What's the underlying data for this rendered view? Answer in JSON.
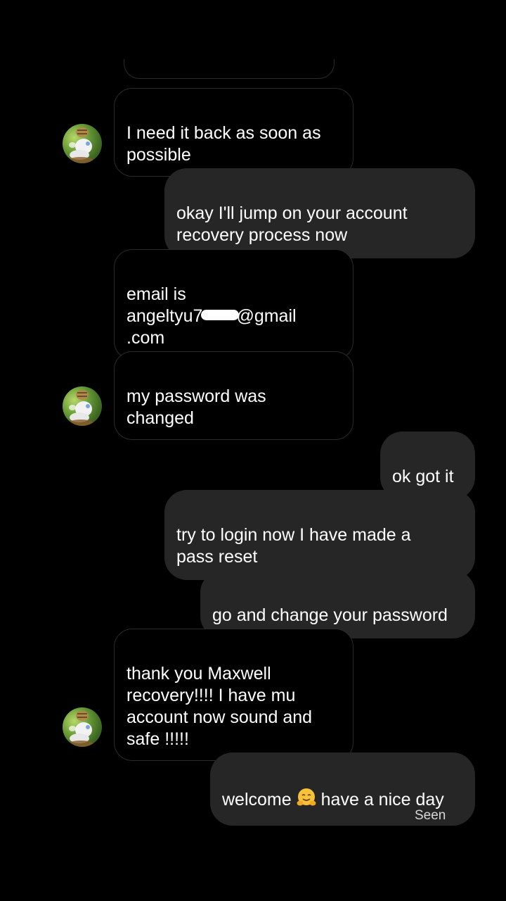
{
  "conversation": {
    "messages": [
      {
        "id": "m1",
        "direction": "incoming",
        "text": "I need it back as soon as\npossible"
      },
      {
        "id": "m2",
        "direction": "outgoing",
        "text": " okay I'll jump on your account\nrecovery process now"
      },
      {
        "id": "m3",
        "direction": "incoming",
        "text_before_redaction": "email is\nangeltyu7",
        "text_after_redaction": "@gmail\n.com"
      },
      {
        "id": "m4",
        "direction": "incoming",
        "text": "my password was\nchanged"
      },
      {
        "id": "m5",
        "direction": "outgoing",
        "text": "ok got it"
      },
      {
        "id": "m6",
        "direction": "outgoing",
        "text": "try to login now I have made a\npass reset"
      },
      {
        "id": "m7",
        "direction": "outgoing",
        "text": "go and change your password"
      },
      {
        "id": "m8",
        "direction": "incoming",
        "text": "thank you Maxwell\nrecovery!!!! I have mu\naccount now sound and\nsafe !!!!!"
      },
      {
        "id": "m9",
        "direction": "outgoing",
        "text_before_emoji": "welcome",
        "emoji": "hugging-face-emoji",
        "text_after_emoji": "have  a nice day"
      }
    ],
    "status": "Seen"
  },
  "theme": {
    "background": "#000000",
    "outgoing_bubble": "#262626",
    "incoming_border": "#2b2b2b",
    "text": "#ffffff"
  }
}
